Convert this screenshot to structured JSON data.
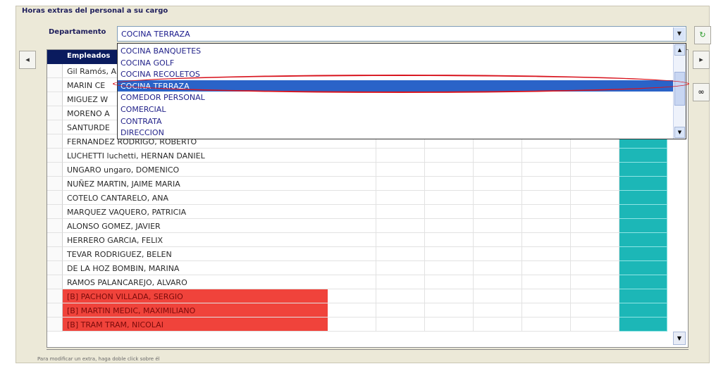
{
  "groupbox": {
    "title": "Horas extras del personal a su cargo"
  },
  "department": {
    "label": "Departamento",
    "value": "COCINA TERRAZA",
    "options": [
      "COCINA BANQUETES",
      "COCINA GOLF",
      "COCINA RECOLETOS",
      "COCINA TERRAZA",
      "COMEDOR PERSONAL",
      "COMERCIAL",
      "CONTRATA",
      "DIRECCION"
    ],
    "selected_index": 3
  },
  "grid": {
    "header": "Empleados",
    "rows": [
      {
        "name": "Gil Ramós, A",
        "red": false
      },
      {
        "name": "MARIN CE",
        "red": false
      },
      {
        "name": "MIGUEZ W",
        "red": false
      },
      {
        "name": "MORENO A",
        "red": false
      },
      {
        "name": "SANTURDE",
        "red": false
      },
      {
        "name": "FERNANDEZ RODRIGO, ROBERTO",
        "red": false
      },
      {
        "name": "LUCHETTI luchetti, HERNAN DANIEL",
        "red": false
      },
      {
        "name": "UNGARO ungaro, DOMENICO",
        "red": false
      },
      {
        "name": "NUÑEZ MARTIN, JAIME MARIA",
        "red": false
      },
      {
        "name": "COTELO  CANTARELO, ANA",
        "red": false
      },
      {
        "name": "MARQUEZ VAQUERO, PATRICIA",
        "red": false
      },
      {
        "name": "ALONSO GOMEZ, JAVIER",
        "red": false
      },
      {
        "name": "HERRERO GARCIA, FELIX",
        "red": false
      },
      {
        "name": "TEVAR RODRIGUEZ, BELEN",
        "red": false
      },
      {
        "name": "DE LA HOZ  BOMBIN, MARINA",
        "red": false
      },
      {
        "name": "RAMOS PALANCAREJO, ALVARO",
        "red": false
      },
      {
        "name": "[B] PACHON VILLADA, SERGIO",
        "red": true
      },
      {
        "name": "[B] MARTIN MEDIC, MAXIMILIANO",
        "red": true
      },
      {
        "name": "[B] TRAM TRAM, NICOLAI",
        "red": true
      }
    ]
  },
  "footer": {
    "hint": "Para modificar un extra, haga doble click sobre él"
  },
  "icons": {
    "refresh": "refresh-icon",
    "prev_record": "previous-record-icon",
    "next_record": "next-record-icon",
    "find": "binoculars-icon"
  },
  "colors": {
    "header_bg": "#0a1b5e",
    "selection": "#2a63c8",
    "red_row": "#f0433b",
    "teal_column": "#1cb7b7",
    "highlight_ellipse": "#d8141e"
  }
}
